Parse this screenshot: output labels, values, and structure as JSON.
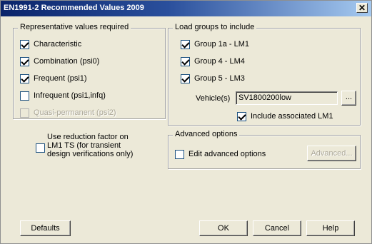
{
  "window": {
    "title": "EN1991-2 Recommended Values 2009",
    "close_glyph": "✕"
  },
  "representative": {
    "caption": "Representative values required",
    "items": [
      {
        "label": "Characteristic",
        "checked": true,
        "enabled": true
      },
      {
        "label": "Combination (psi0)",
        "checked": true,
        "enabled": true
      },
      {
        "label": "Frequent (psi1)",
        "checked": true,
        "enabled": true
      },
      {
        "label": "Infrequent (psi1,infq)",
        "checked": false,
        "enabled": true
      },
      {
        "label": "Quasi-permanent (psi2)",
        "checked": false,
        "enabled": false
      }
    ]
  },
  "load_groups": {
    "caption": "Load groups to include",
    "items": [
      {
        "label": "Group 1a - LM1",
        "checked": true
      },
      {
        "label": "Group 4 - LM4",
        "checked": true
      },
      {
        "label": "Group 5 - LM3",
        "checked": true
      }
    ],
    "vehicle_label": "Vehicle(s)",
    "vehicle_value": "SV1800200low",
    "browse_label": "...",
    "include_lm1_label": "Include associated LM1",
    "include_lm1_checked": true
  },
  "reduction": {
    "line1": "Use reduction factor on",
    "line2": "LM1 TS (for transient",
    "line3": "design verifications only)",
    "checked": false
  },
  "advanced": {
    "caption": "Advanced options",
    "edit_label": "Edit advanced options",
    "edit_checked": false,
    "button_label": "Advanced..."
  },
  "buttons": {
    "defaults": "Defaults",
    "ok": "OK",
    "cancel": "Cancel",
    "help": "Help"
  }
}
